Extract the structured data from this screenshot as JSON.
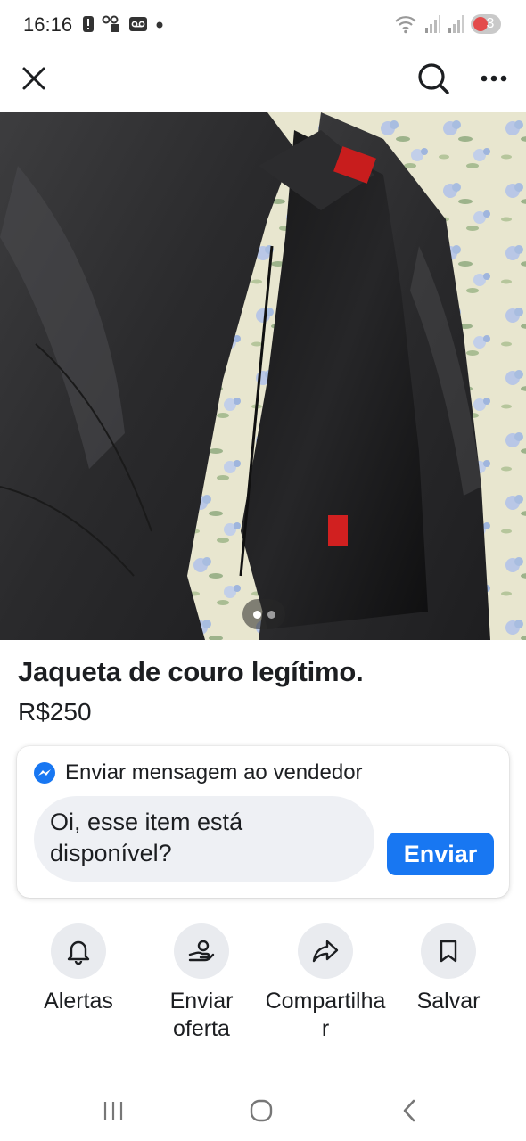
{
  "status_bar": {
    "time": "16:16",
    "battery_level": "3",
    "icons": [
      "alert-icon",
      "vpn-icon",
      "voicemail-icon",
      "dot-icon",
      "wifi-icon",
      "signal-icon",
      "signal-icon",
      "battery-icon"
    ]
  },
  "app_bar": {
    "icons": [
      "close-icon",
      "search-icon",
      "more-icon"
    ]
  },
  "listing": {
    "title": "Jaqueta de couro legítimo.",
    "price": "R$250",
    "photo_count": 2,
    "current_photo": 1
  },
  "message": {
    "header": "Enviar mensagem ao vendedor",
    "text": "Oi, esse item está disponível?",
    "send_label": "Enviar"
  },
  "actions": [
    {
      "label": "Alertas",
      "icon": "bell-icon"
    },
    {
      "label": "Enviar oferta",
      "icon": "offer-icon"
    },
    {
      "label": "Compartilhar",
      "icon": "share-icon"
    },
    {
      "label": "Salvar",
      "icon": "bookmark-icon"
    }
  ],
  "colors": {
    "accent": "#1877f2",
    "action_bg": "#e9ebef"
  }
}
